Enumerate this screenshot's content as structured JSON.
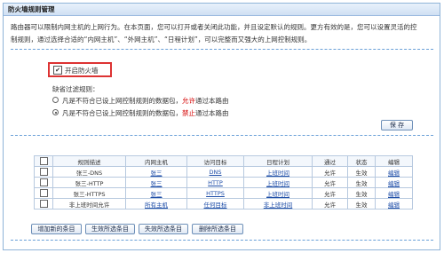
{
  "window": {
    "title": "防火墙规则管理"
  },
  "description": {
    "line1": "路由器可以限制内网主机的上网行为。在本页面，您可以打开或者关闭此功能，并且设定默认的规则。更方有效的是，您可以设置灵活的控",
    "line2": "制规则，通过选择合适的“内网主机”、“外网主机”、“日程计划”，可以完整而又强大的上网控制规则。"
  },
  "firewall": {
    "enable_label": "开启防火墙",
    "enabled": true,
    "default_rule_label": "缺省过滤规则：",
    "options": [
      {
        "prefix": "凡是不符合已设上网控制规则的数据包，",
        "action": "允许",
        "suffix": "通过本路由",
        "selected": false
      },
      {
        "prefix": "凡是不符合已设上网控制规则的数据包，",
        "action": "禁止",
        "suffix": "通过本路由",
        "selected": true
      }
    ],
    "save_label": "保 存"
  },
  "table": {
    "headers": [
      "",
      "规则描述",
      "内网主机",
      "访问目标",
      "日程计划",
      "通过",
      "状态",
      "编辑"
    ],
    "rows": [
      {
        "desc": "张三-DNS",
        "host": "张三",
        "target": "DNS",
        "schedule": "上班时间",
        "pass": "允许",
        "status": "生效",
        "edit": "编辑"
      },
      {
        "desc": "张三-HTTP",
        "host": "张三",
        "target": "HTTP",
        "schedule": "上班时间",
        "pass": "允许",
        "status": "生效",
        "edit": "编辑"
      },
      {
        "desc": "张三-HTTPS",
        "host": "张三",
        "target": "HTTPS",
        "schedule": "上班时间",
        "pass": "允许",
        "status": "生效",
        "edit": "编辑"
      },
      {
        "desc": "非上班时间允许",
        "host": "所有主机",
        "target": "任何目标",
        "schedule": "非上班时间",
        "pass": "允许",
        "status": "生效",
        "edit": "编辑"
      }
    ]
  },
  "actions": {
    "add": "增加新的条目",
    "enable": "生效所选条目",
    "disable": "失效所选条目",
    "delete": "删除所选条目"
  },
  "colors": {
    "accent_red": "#d40000",
    "frame_blue": "#8fb4d8",
    "link_blue": "#1f4ea8"
  }
}
